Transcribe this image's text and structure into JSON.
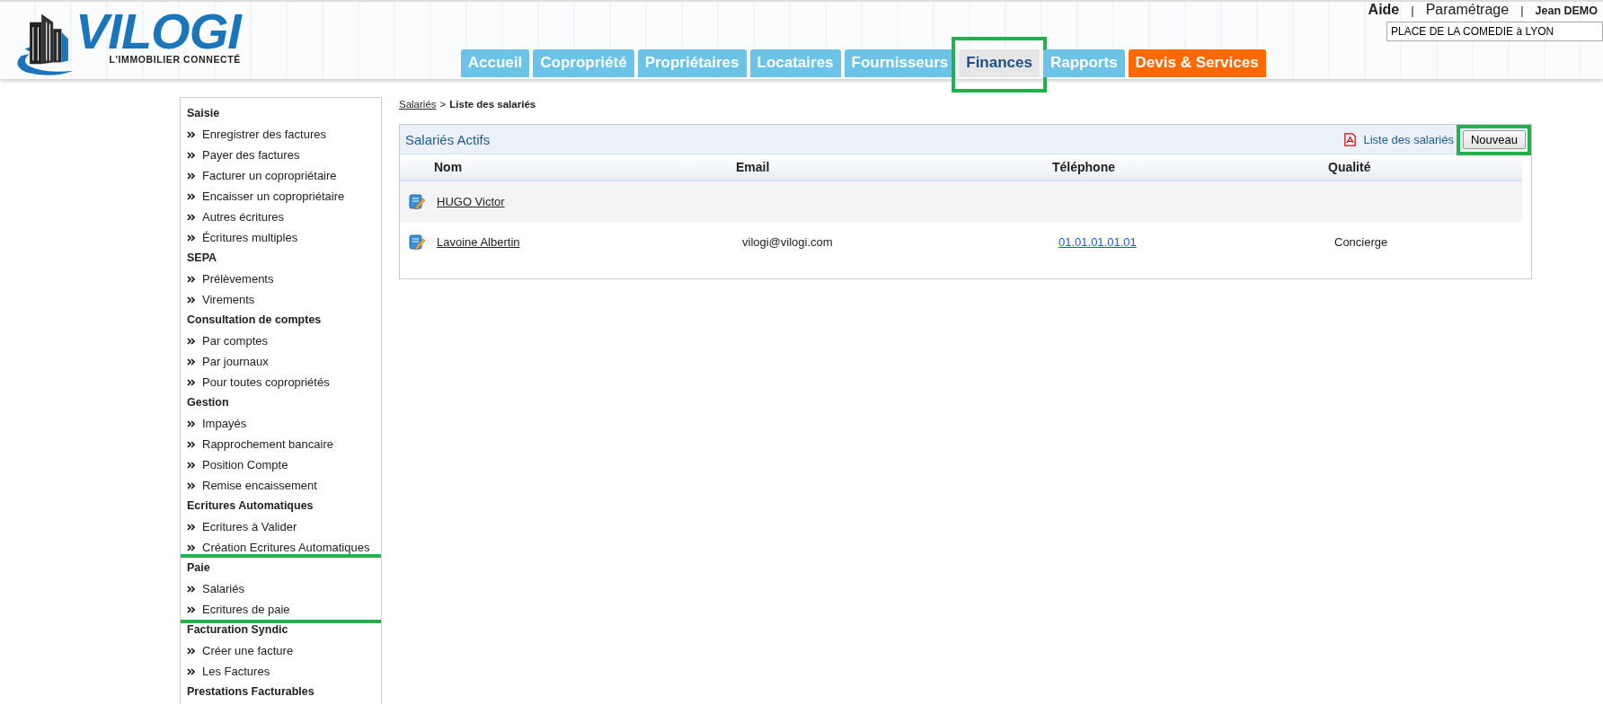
{
  "header": {
    "logo": {
      "name": "VILOGI",
      "tagline": "L'IMMOBILIER CONNECTÉ"
    },
    "top_links": [
      {
        "kind": "help",
        "label": "Aide"
      },
      {
        "kind": "separator",
        "label": "|"
      },
      {
        "kind": "link",
        "label": "Paramétrage"
      },
      {
        "kind": "separator",
        "label": "|"
      },
      {
        "kind": "user",
        "label": "Jean DEMO"
      }
    ],
    "site_field": {
      "value": "PLACE DE LA COMEDIE à LYON"
    },
    "tabs": [
      {
        "label": "Accueil",
        "kind": "normal",
        "selected": false,
        "highlighted": false
      },
      {
        "label": "Copropriété",
        "kind": "normal",
        "selected": false,
        "highlighted": false
      },
      {
        "label": "Propriétaires",
        "kind": "normal",
        "selected": false,
        "highlighted": false
      },
      {
        "label": "Locataires",
        "kind": "normal",
        "selected": false,
        "highlighted": false
      },
      {
        "label": "Fournisseurs",
        "kind": "normal",
        "selected": false,
        "highlighted": false
      },
      {
        "label": "Finances",
        "kind": "normal",
        "selected": true,
        "highlighted": true
      },
      {
        "label": "Rapports",
        "kind": "normal",
        "selected": false,
        "highlighted": false
      },
      {
        "label": "Devis & Services",
        "kind": "promo",
        "selected": false,
        "highlighted": false
      }
    ]
  },
  "sidebar": {
    "sections": [
      {
        "title": "Saisie",
        "highlighted": false,
        "items": [
          "Enregistrer des factures",
          "Payer des factures",
          "Facturer un copropriétaire",
          "Encaisser un copropriétaire",
          "Autres écritures",
          "Écritures multiples"
        ]
      },
      {
        "title": "SEPA",
        "highlighted": false,
        "items": [
          "Prélèvements",
          "Virements"
        ]
      },
      {
        "title": "Consultation de comptes",
        "highlighted": false,
        "items": [
          "Par comptes",
          "Par journaux",
          "Pour toutes copropriétés"
        ]
      },
      {
        "title": "Gestion",
        "highlighted": false,
        "items": [
          "Impayés",
          "Rapprochement bancaire",
          "Position Compte",
          "Remise encaissement"
        ]
      },
      {
        "title": "Ecritures Automatiques",
        "highlighted": false,
        "items": [
          "Ecritures à Valider",
          "Création Ecritures Automatiques"
        ]
      },
      {
        "title": "Paie",
        "highlighted": true,
        "items": [
          "Salariés",
          "Ecritures de paie"
        ]
      },
      {
        "title": "Facturation Syndic",
        "highlighted": false,
        "items": [
          "Créer une facture",
          "Les Factures"
        ]
      },
      {
        "title": "Prestations Facturables",
        "highlighted": false
      }
    ]
  },
  "breadcrumb": {
    "link": "Salariés",
    "separator": ">",
    "current": "Liste des salariés"
  },
  "panel": {
    "title": "Salariés Actifs",
    "export_link": "Liste des salariés",
    "new_button": {
      "label": "Nouveau",
      "highlighted": true
    },
    "columns": [
      "Nom",
      "Email",
      "Téléphone",
      "Qualité"
    ],
    "rows": [
      {
        "name": "HUGO Victor"
      },
      {
        "name": "Lavoine Albertin",
        "email": "vilogi@vilogi.com",
        "phone": "01.01.01.01.01",
        "role": "Concierge"
      }
    ]
  }
}
